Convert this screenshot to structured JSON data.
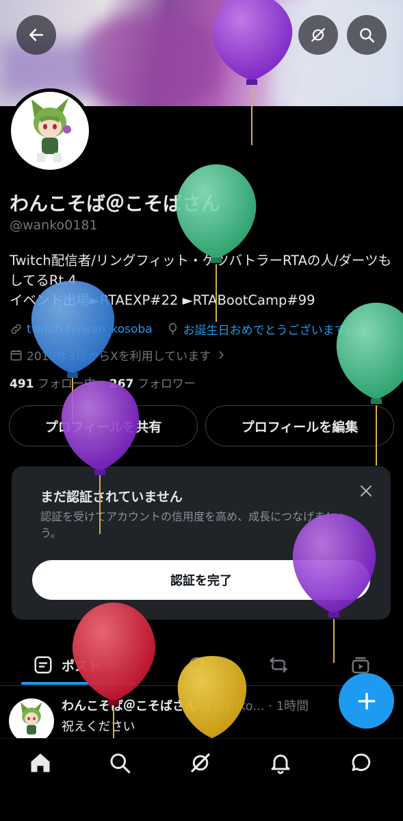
{
  "header": {
    "back_icon": "arrow-left-icon",
    "grok_icon": "grok-icon",
    "search_icon": "search-icon"
  },
  "profile": {
    "name": "わんこそば＠こそばさん",
    "handle": "@wanko0181",
    "bio": "Twitch配信者/リングフィット・ケツバトラーRTAの人/ダーツもしてるRt.4\nイベント出場►RTAEXP#22 ►RTABootCamp#99",
    "website": "twitch.tv/wan_kosoba",
    "birthday": "お誕生日おめでとうございます。",
    "joined": "2019年3月からXを利用しています",
    "following_count": "491",
    "following_label": "フォロー中",
    "followers_count": "267",
    "followers_label": "フォロワー"
  },
  "buttons": {
    "share": "プロフィールを共有",
    "edit": "プロフィールを編集"
  },
  "verify": {
    "title": "まだ認証されていません",
    "description": "認証を受けてアカウントの信用度を高め、成長につなげましょう。",
    "button": "認証を完了"
  },
  "tabs": {
    "posts_label": "ポスト"
  },
  "post": {
    "name": "わんこそば＠こそばさん",
    "meta": "@wanko... · 1時間",
    "text": "祝えください"
  },
  "colors": {
    "accent": "#1d9bf0",
    "background": "#000000",
    "card": "#202327"
  }
}
